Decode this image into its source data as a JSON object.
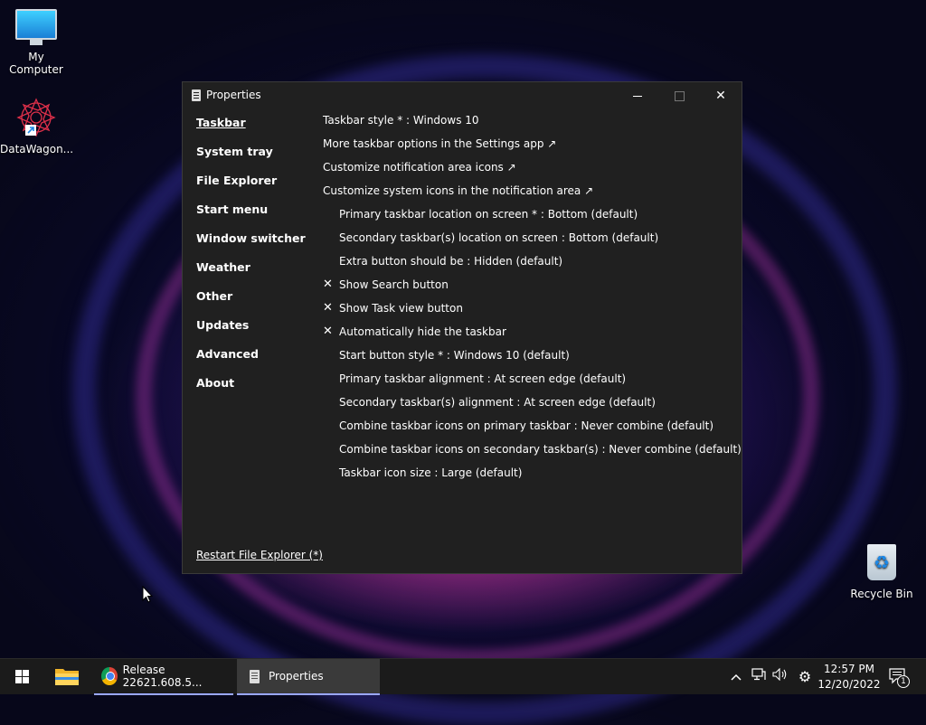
{
  "desktop": {
    "icons": [
      {
        "label": "My Computer",
        "icon": "monitor-icon"
      },
      {
        "label": "DataWagon...",
        "icon": "datawagon-icon"
      },
      {
        "label": "Recycle Bin",
        "icon": "recycle-bin-icon"
      }
    ]
  },
  "window": {
    "title": "Properties",
    "controls": {
      "minimize": "",
      "maximize": "",
      "close": "✕"
    },
    "nav": [
      {
        "label": "Taskbar",
        "active": true
      },
      {
        "label": "System tray"
      },
      {
        "label": "File Explorer"
      },
      {
        "label": "Start menu"
      },
      {
        "label": "Window switcher"
      },
      {
        "label": "Weather"
      },
      {
        "label": "Other"
      },
      {
        "label": "Updates"
      },
      {
        "label": "Advanced"
      },
      {
        "label": "About"
      }
    ],
    "settings": [
      {
        "text": "Taskbar style * : Windows 10",
        "indent": false,
        "checked": false
      },
      {
        "text": "More taskbar options in the Settings app ↗",
        "indent": false,
        "checked": false
      },
      {
        "text": "Customize notification area icons ↗",
        "indent": false,
        "checked": false
      },
      {
        "text": "Customize system icons in the notification area ↗",
        "indent": false,
        "checked": false
      },
      {
        "text": "Primary taskbar location on screen * : Bottom (default)",
        "indent": true,
        "checked": false
      },
      {
        "text": "Secondary taskbar(s) location on screen : Bottom (default)",
        "indent": true,
        "checked": false
      },
      {
        "text": "Extra button should be : Hidden (default)",
        "indent": true,
        "checked": false
      },
      {
        "text": "Show Search button",
        "indent": true,
        "checked": true
      },
      {
        "text": "Show Task view button",
        "indent": true,
        "checked": true
      },
      {
        "text": "Automatically hide the taskbar",
        "indent": true,
        "checked": true
      },
      {
        "text": "Start button style * : Windows 10 (default)",
        "indent": true,
        "checked": false
      },
      {
        "text": "Primary taskbar alignment : At screen edge (default)",
        "indent": true,
        "checked": false
      },
      {
        "text": "Secondary taskbar(s) alignment : At screen edge (default)",
        "indent": true,
        "checked": false
      },
      {
        "text": "Combine taskbar icons on primary taskbar : Never combine (default)",
        "indent": true,
        "checked": false
      },
      {
        "text": "Combine taskbar icons on secondary taskbar(s) : Never combine (default)",
        "indent": true,
        "checked": false
      },
      {
        "text": "Taskbar icon size : Large (default)",
        "indent": true,
        "checked": false
      }
    ],
    "check_mark": "✕",
    "restart_link": "Restart File Explorer (*)"
  },
  "taskbar": {
    "chrome_label": "Release 22621.608.5...",
    "properties_label": "Properties",
    "tray": {
      "chevron": "^",
      "network": "🖧",
      "volume": "🔊",
      "settings": "⚙"
    },
    "time": "12:57 PM",
    "date": "12/20/2022",
    "notification_count": "1"
  }
}
